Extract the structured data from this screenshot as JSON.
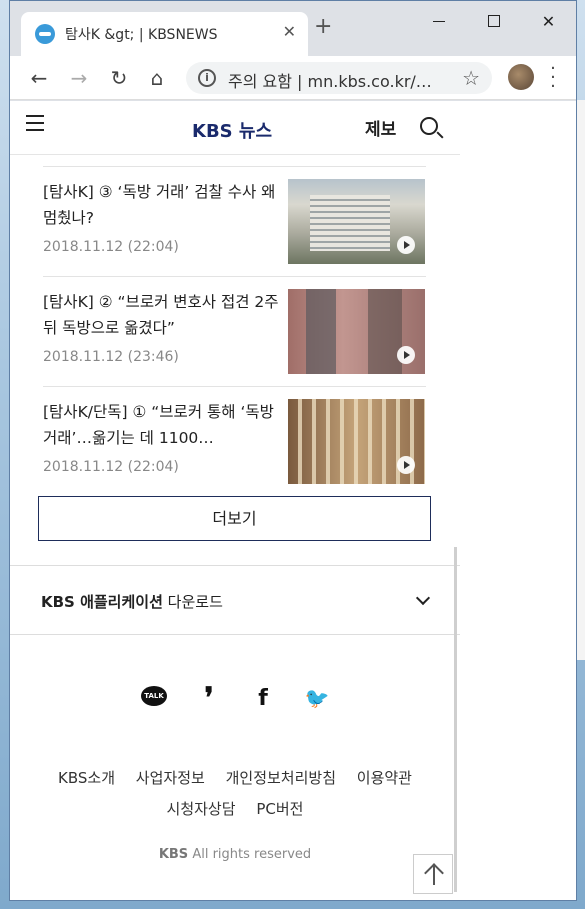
{
  "browser": {
    "tab_title": "탐사K &gt; | KBSNEWS",
    "new_tab": "+",
    "omnibox_text": "주의 요함 | mn.kbs.co.kr/…",
    "info_icon": "i"
  },
  "site": {
    "logo": "KBS 뉴스",
    "report": "제보"
  },
  "news": [
    {
      "title": "[탐사K] ③ ‘독방 거래’ 검찰 수사 왜 멈췄나?",
      "date": "2018.11.12 (22:04)"
    },
    {
      "title": "[탐사K] ② “브로커 변호사 접견 2주 뒤 독방으로 옮겼다”",
      "date": "2018.11.12 (23:46)"
    },
    {
      "title": "[탐사K/단독] ① “브로커 통해 ‘독방 거래’…옮기는 데 1100…",
      "date": "2018.11.12 (22:04)"
    }
  ],
  "more_button": "더보기",
  "app_download": {
    "brand": "KBS 애플리케이션",
    "label": "다운로드"
  },
  "social": {
    "talk": "TALK"
  },
  "footer": {
    "links_row1": [
      "KBS소개",
      "사업자정보",
      "개인정보처리방침",
      "이용약관"
    ],
    "links_row2": [
      "시청자상담",
      "PC버전"
    ],
    "copyright_brand": "KBS",
    "copyright": "All rights reserved"
  }
}
